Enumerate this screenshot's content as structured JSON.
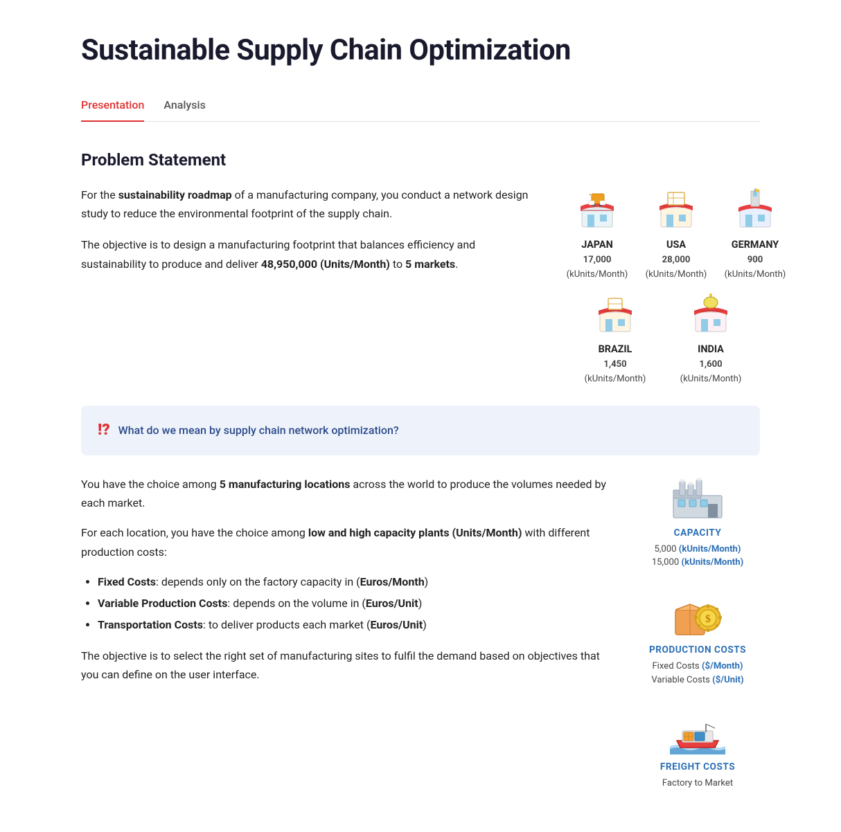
{
  "page": {
    "title": "Sustainable Supply Chain Optimization",
    "tabs": [
      {
        "label": "Presentation",
        "active": true
      },
      {
        "label": "Analysis",
        "active": false
      }
    ]
  },
  "problem_statement": {
    "section_title": "Problem Statement",
    "para1": "For the ",
    "para1_bold": "sustainability roadmap",
    "para1_rest": " of a manufacturing company, you conduct a network design study to reduce the environmental footprint of the supply chain.",
    "para2_start": "The objective is to design a manufacturing footprint that balances efficiency and sustainability to produce and deliver ",
    "para2_bold": "48,950,000 (Units/Month)",
    "para2_end": " to ",
    "para2_bold2": "5 markets",
    "para2_period": ".",
    "markets": [
      {
        "name": "JAPAN",
        "volume": "17,000",
        "unit": "(kUnits/Month)",
        "row": 1
      },
      {
        "name": "USA",
        "volume": "28,000",
        "unit": "(kUnits/Month)",
        "row": 1
      },
      {
        "name": "GERMANY",
        "volume": "900",
        "unit": "(kUnits/Month)",
        "row": 1
      },
      {
        "name": "BRAZIL",
        "volume": "1,450",
        "unit": "(kUnits/Month)",
        "row": 2
      },
      {
        "name": "INDIA",
        "volume": "1,600",
        "unit": "(kUnits/Month)",
        "row": 2
      }
    ]
  },
  "callout": {
    "icon": "!?",
    "text": "What do we mean by supply chain network optimization?"
  },
  "section2": {
    "para1_start": "You have the choice among ",
    "para1_bold": "5 manufacturing locations",
    "para1_end": " across the world to produce the volumes needed by each market.",
    "para2_start": "For each location, you have the choice among ",
    "para2_bold": "low and high capacity plants (Units/Month)",
    "para2_end": " with different production costs:",
    "bullet1_bold": "Fixed Costs",
    "bullet1_rest": ": depends only on the factory capacity in (Euros/Month)",
    "bullet2_bold": "Variable Production Costs",
    "bullet2_rest": ": depends on the volume in (Euros/Unit)",
    "bullet3_bold": "Transportation Costs",
    "bullet3_rest": ": to deliver products each market (Euros/Unit)",
    "para3": "The objective is to select the right set of manufacturing sites to fulfil the demand based on objectives that you can define on the user interface.",
    "cards": [
      {
        "id": "capacity",
        "title": "CAPACITY",
        "line1": "5,000 ",
        "line1_bold": "(kUnits/Month)",
        "line2": "15,000 ",
        "line2_bold": "(kUnits/Month)"
      },
      {
        "id": "production_costs",
        "title": "PRODUCTION COSTS",
        "line1": "Fixed Costs ",
        "line1_bold": "($/Month)",
        "line2": "Variable Costs ",
        "line2_bold": "($/Unit)"
      },
      {
        "id": "freight_costs",
        "title": "FREIGHT COSTS",
        "line1": "Factory to Market"
      }
    ]
  }
}
